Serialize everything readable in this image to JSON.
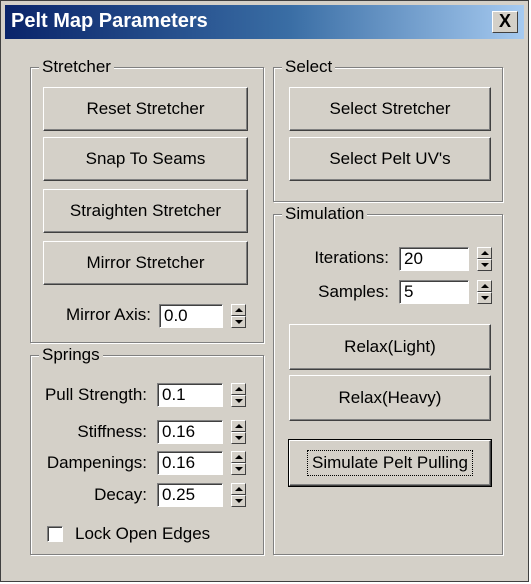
{
  "window": {
    "title": "Pelt Map Parameters",
    "close_label": "X"
  },
  "stretcher": {
    "legend": "Stretcher",
    "reset": "Reset Stretcher",
    "snap": "Snap To Seams",
    "straighten": "Straighten Stretcher",
    "mirror": "Mirror Stretcher",
    "mirror_axis_label": "Mirror Axis:",
    "mirror_axis_value": "0.0"
  },
  "select": {
    "legend": "Select",
    "select_stretcher": "Select Stretcher",
    "select_pelt_uvs": "Select Pelt UV's"
  },
  "springs": {
    "legend": "Springs",
    "pull_strength_label": "Pull Strength:",
    "pull_strength_value": "0.1",
    "stiffness_label": "Stiffness:",
    "stiffness_value": "0.16",
    "dampenings_label": "Dampenings:",
    "dampenings_value": "0.16",
    "decay_label": "Decay:",
    "decay_value": "0.25",
    "lock_open_edges_label": "Lock Open Edges",
    "lock_open_edges_checked": false
  },
  "simulation": {
    "legend": "Simulation",
    "iterations_label": "Iterations:",
    "iterations_value": "20",
    "samples_label": "Samples:",
    "samples_value": "5",
    "relax_light": "Relax(Light)",
    "relax_heavy": "Relax(Heavy)",
    "simulate": "Simulate Pelt Pulling"
  }
}
